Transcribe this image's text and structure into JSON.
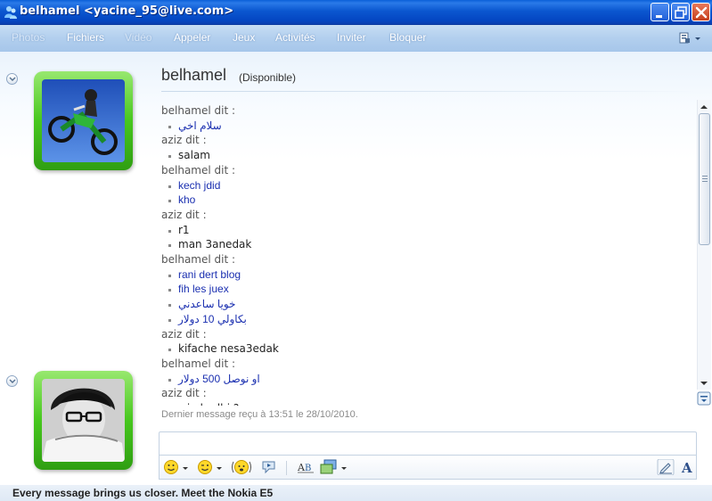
{
  "window": {
    "title": "belhamel <yacine_95@live.com>"
  },
  "menu": {
    "items": [
      {
        "label": "Photos",
        "enabled": false
      },
      {
        "label": "Fichiers",
        "enabled": true
      },
      {
        "label": "Vidéo",
        "enabled": false
      },
      {
        "label": "Appeler",
        "enabled": true
      },
      {
        "label": "Jeux",
        "enabled": true
      },
      {
        "label": "Activités",
        "enabled": true
      },
      {
        "label": "Inviter",
        "enabled": true
      },
      {
        "label": "Bloquer",
        "enabled": true
      }
    ]
  },
  "contact": {
    "name": "belhamel",
    "status": "(Disponible)"
  },
  "conversation": [
    {
      "type": "sender",
      "text": "belhamel dit :"
    },
    {
      "type": "msg",
      "from": "contact",
      "text": "سلام اخي"
    },
    {
      "type": "sender",
      "text": "aziz dit :"
    },
    {
      "type": "msg",
      "from": "self",
      "text": "salam"
    },
    {
      "type": "sender",
      "text": "belhamel dit :"
    },
    {
      "type": "msg",
      "from": "contact",
      "text": "kech jdid"
    },
    {
      "type": "msg",
      "from": "contact",
      "text": "kho"
    },
    {
      "type": "sender",
      "text": "aziz dit :"
    },
    {
      "type": "msg",
      "from": "self",
      "text": "r1"
    },
    {
      "type": "msg",
      "from": "self",
      "text": "man 3anedak"
    },
    {
      "type": "sender",
      "text": "belhamel dit :"
    },
    {
      "type": "msg",
      "from": "contact",
      "text": "rani dert blog"
    },
    {
      "type": "msg",
      "from": "contact",
      "text": "fih les juex"
    },
    {
      "type": "msg",
      "from": "contact",
      "text": "خويا ساعدني"
    },
    {
      "type": "msg",
      "from": "contact",
      "text": "بكاولي 10 دولار"
    },
    {
      "type": "sender",
      "text": "aziz dit :"
    },
    {
      "type": "msg",
      "from": "self",
      "text": "kifache nesa3edak"
    },
    {
      "type": "sender",
      "text": "belhamel dit :"
    },
    {
      "type": "msg",
      "from": "contact",
      "text": "او نوصل 500 دولار"
    },
    {
      "type": "sender",
      "text": "aziz dit :"
    },
    {
      "type": "msg",
      "from": "self",
      "text": "win hadhi ?"
    }
  ],
  "footer": {
    "last_message": "Dernier message reçu à 13:51 le 28/10/2010.",
    "input_value": "",
    "ad_text": "Every message brings us closer. Meet the Nokia E5"
  },
  "colors": {
    "title_bar": "#0b57d0",
    "avatar_frame": "#47c71e",
    "contact_text": "#1a2fb0",
    "sender_text": "#555555"
  }
}
